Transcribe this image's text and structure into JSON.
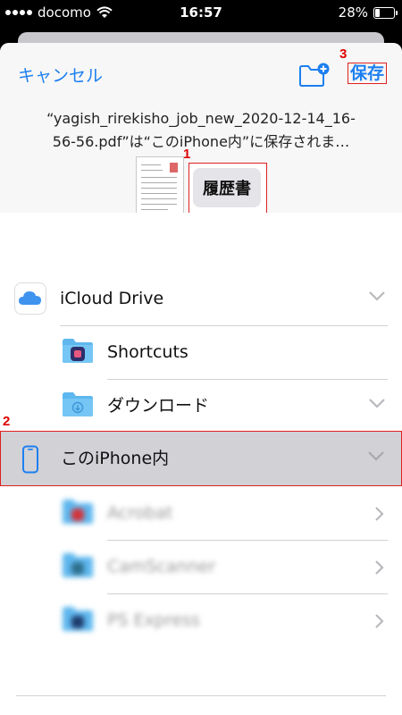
{
  "status_bar": {
    "carrier": "docomo",
    "time": "16:57",
    "battery": "28%",
    "battery_level": 0.28
  },
  "header": {
    "cancel_label": "キャンセル",
    "save_label": "保存",
    "filename_line1": "“yagish_rirekisho_job_new_2020-12-14_16-",
    "filename_line2": "56-56.pdf”は“このiPhone内”に保存されま…",
    "tag_label": "履歴書"
  },
  "annotations": {
    "n1": "1",
    "n2": "2",
    "n3": "3"
  },
  "locations": [
    {
      "label": "iCloud Drive",
      "icon": "icloud-icon",
      "control": "chevron-down"
    },
    {
      "label": "Shortcuts",
      "icon": "shortcuts-folder-icon"
    },
    {
      "label": "ダウンロード",
      "icon": "download-folder-icon",
      "control": "chevron-down"
    },
    {
      "label": "このiPhone内",
      "icon": "iphone-icon",
      "control": "chevron-down",
      "selected": true
    },
    {
      "label": "Acrobat",
      "icon": "acrobat-folder-icon",
      "control": "chevron-right"
    },
    {
      "label": "CamScanner",
      "icon": "camscanner-folder-icon",
      "control": "chevron-right"
    },
    {
      "label": "PS Express",
      "icon": "psexpress-folder-icon",
      "control": "chevron-right"
    }
  ],
  "colors": {
    "accent": "#1d7ff0",
    "annotation": "#e02020",
    "selected_row": "#d1d1d6"
  }
}
